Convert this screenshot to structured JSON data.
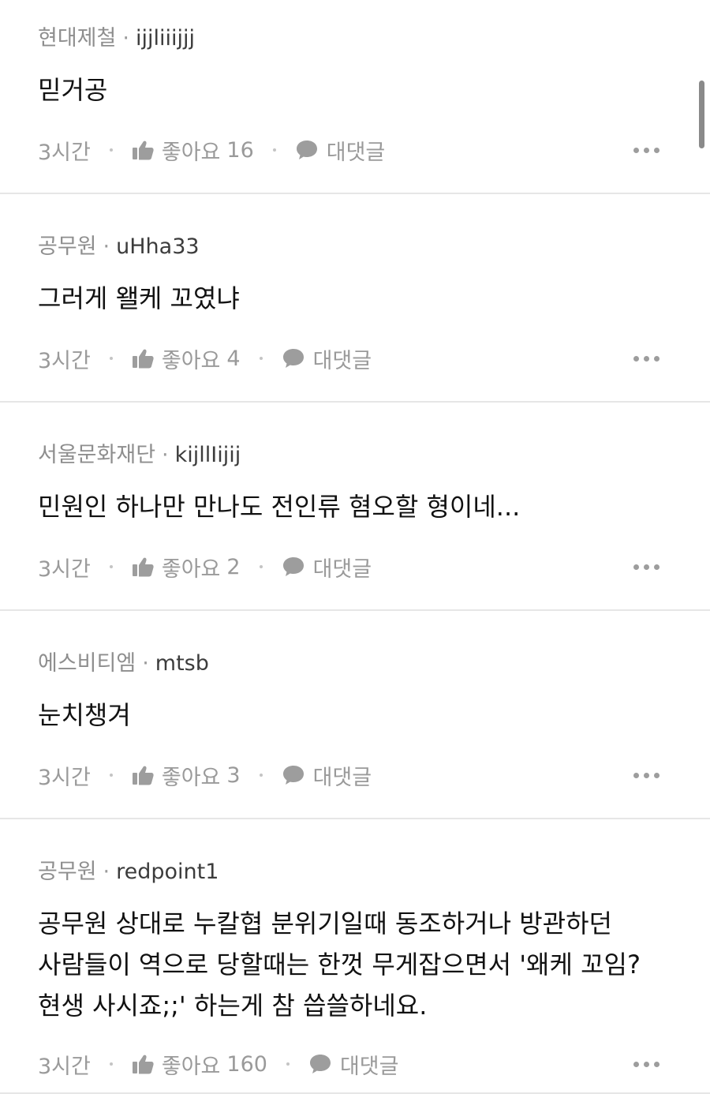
{
  "comments": [
    {
      "affiliation": "현대제철",
      "nickname": "ijjliiijjj",
      "text": "믿거공",
      "time": "3시간",
      "like_label": "좋아요",
      "like_count": "16",
      "reply_label": "대댓글"
    },
    {
      "affiliation": "공무원",
      "nickname": "uHha33",
      "text": "그러게 왤케 꼬였냐",
      "time": "3시간",
      "like_label": "좋아요",
      "like_count": "4",
      "reply_label": "대댓글"
    },
    {
      "affiliation": "서울문화재단",
      "nickname": "kijllIijij",
      "text": "민원인 하나만 만나도 전인류 혐오할 형이네...",
      "time": "3시간",
      "like_label": "좋아요",
      "like_count": "2",
      "reply_label": "대댓글"
    },
    {
      "affiliation": "에스비티엠",
      "nickname": "mtsb",
      "text": "눈치챙겨",
      "time": "3시간",
      "like_label": "좋아요",
      "like_count": "3",
      "reply_label": "대댓글"
    },
    {
      "affiliation": "공무원",
      "nickname": "redpoint1",
      "text": "공무원 상대로 누칼협 분위기일때 동조하거나 방관하던\n사람들이 역으로 당할때는 한껏 무게잡으면서 '왜케 꼬임?\n현생 사시죠;;' 하는게 참 씁쓸하네요.",
      "time": "3시간",
      "like_label": "좋아요",
      "like_count": "160",
      "reply_label": "대댓글"
    }
  ],
  "meta_separator": "·",
  "icons": {
    "like": "thumbs-up-icon",
    "reply": "speech-bubble-icon",
    "more": "more-dots-icon"
  },
  "colors": {
    "meta": "#8e8e8e",
    "body": "#111111",
    "muted": "#9a9a9a",
    "divider": "#e6e6e6"
  }
}
